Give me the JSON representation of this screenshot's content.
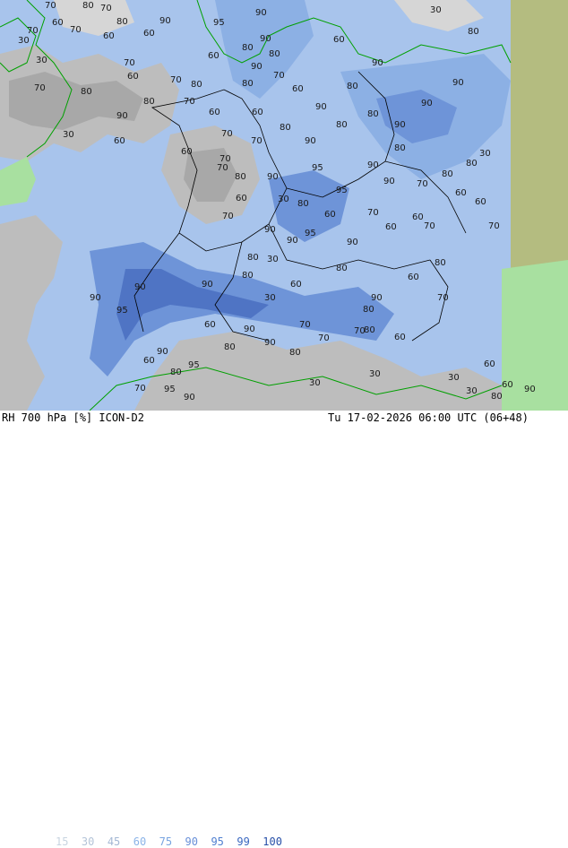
{
  "footer": {
    "product": "RH 700 hPa [%] ICON-D2",
    "datetime": "Tu 17-02-2026 06:00 UTC (06+48)"
  },
  "legend": {
    "values": [
      "15",
      "30",
      "45",
      "60",
      "75",
      "90",
      "95",
      "99",
      "100"
    ],
    "colors": [
      "#c8d4e0",
      "#b4c4d8",
      "#a4b8d4",
      "#8cb4e8",
      "#78a4e0",
      "#6890d8",
      "#4f7fd0",
      "#3a68c0",
      "#2850a8"
    ]
  },
  "map": {
    "colors": {
      "dry_gray": "#a8a8a8",
      "mid_gray": "#bdbdbd",
      "light_gray": "#d6d6d6",
      "moist_blue_1": "#a8c4ec",
      "moist_blue_2": "#8cb0e4",
      "moist_blue_3": "#6e94d8",
      "moist_blue_4": "#4f74c4",
      "green_land": "#a8e0a0",
      "olive_land": "#b4bc80",
      "borders": "#000000",
      "coast": "#00a000"
    },
    "contour_labels": [
      {
        "t": "70"
      },
      {
        "t": "80"
      },
      {
        "t": "70"
      },
      {
        "t": "30"
      },
      {
        "t": "90"
      },
      {
        "t": "95"
      },
      {
        "t": "90"
      },
      {
        "t": "60"
      },
      {
        "t": "70"
      },
      {
        "t": "80"
      },
      {
        "t": "30"
      },
      {
        "t": "70"
      },
      {
        "t": "60"
      },
      {
        "t": "60"
      },
      {
        "t": "80"
      },
      {
        "t": "90"
      },
      {
        "t": "60"
      },
      {
        "t": "60"
      },
      {
        "t": "90"
      },
      {
        "t": "80"
      },
      {
        "t": "70"
      },
      {
        "t": "80"
      },
      {
        "t": "30"
      },
      {
        "t": "60"
      },
      {
        "t": "70"
      },
      {
        "t": "80"
      },
      {
        "t": "90"
      },
      {
        "t": "60"
      },
      {
        "t": "70"
      },
      {
        "t": "80"
      },
      {
        "t": "90"
      },
      {
        "t": "80"
      },
      {
        "t": "90"
      },
      {
        "t": "70"
      },
      {
        "t": "80"
      },
      {
        "t": "90"
      },
      {
        "t": "80"
      },
      {
        "t": "70"
      },
      {
        "t": "60"
      },
      {
        "t": "80"
      },
      {
        "t": "90"
      },
      {
        "t": "70"
      },
      {
        "t": "60"
      },
      {
        "t": "80"
      },
      {
        "t": "90"
      },
      {
        "t": "30"
      },
      {
        "t": "60"
      },
      {
        "t": "70"
      },
      {
        "t": "80"
      },
      {
        "t": "90"
      },
      {
        "t": "80"
      },
      {
        "t": "70"
      },
      {
        "t": "60"
      },
      {
        "t": "70"
      },
      {
        "t": "80"
      },
      {
        "t": "90"
      },
      {
        "t": "95"
      },
      {
        "t": "90"
      },
      {
        "t": "80"
      },
      {
        "t": "70"
      },
      {
        "t": "60"
      },
      {
        "t": "30"
      },
      {
        "t": "60"
      },
      {
        "t": "70"
      },
      {
        "t": "80"
      },
      {
        "t": "90"
      },
      {
        "t": "95"
      },
      {
        "t": "90"
      },
      {
        "t": "80"
      },
      {
        "t": "70"
      },
      {
        "t": "60"
      },
      {
        "t": "80"
      },
      {
        "t": "90"
      },
      {
        "t": "95"
      },
      {
        "t": "90"
      },
      {
        "t": "70"
      },
      {
        "t": "60"
      },
      {
        "t": "30"
      },
      {
        "t": "60"
      },
      {
        "t": "80"
      },
      {
        "t": "90"
      },
      {
        "t": "95"
      },
      {
        "t": "90"
      },
      {
        "t": "80"
      },
      {
        "t": "60"
      },
      {
        "t": "30"
      },
      {
        "t": "90"
      },
      {
        "t": "80"
      },
      {
        "t": "70"
      },
      {
        "t": "60"
      },
      {
        "t": "80"
      },
      {
        "t": "90"
      },
      {
        "t": "80"
      },
      {
        "t": "70"
      },
      {
        "t": "60"
      },
      {
        "t": "80"
      },
      {
        "t": "90"
      },
      {
        "t": "95"
      },
      {
        "t": "90"
      },
      {
        "t": "80"
      },
      {
        "t": "70"
      },
      {
        "t": "60"
      },
      {
        "t": "30"
      },
      {
        "t": "30"
      },
      {
        "t": "60"
      },
      {
        "t": "70"
      },
      {
        "t": "80"
      },
      {
        "t": "90"
      },
      {
        "t": "95"
      },
      {
        "t": "90"
      },
      {
        "t": "70"
      },
      {
        "t": "60"
      },
      {
        "t": "30"
      },
      {
        "t": "30"
      },
      {
        "t": "60"
      },
      {
        "t": "80"
      },
      {
        "t": "90"
      },
      {
        "t": "70"
      },
      {
        "t": "60"
      },
      {
        "t": "30"
      }
    ]
  }
}
